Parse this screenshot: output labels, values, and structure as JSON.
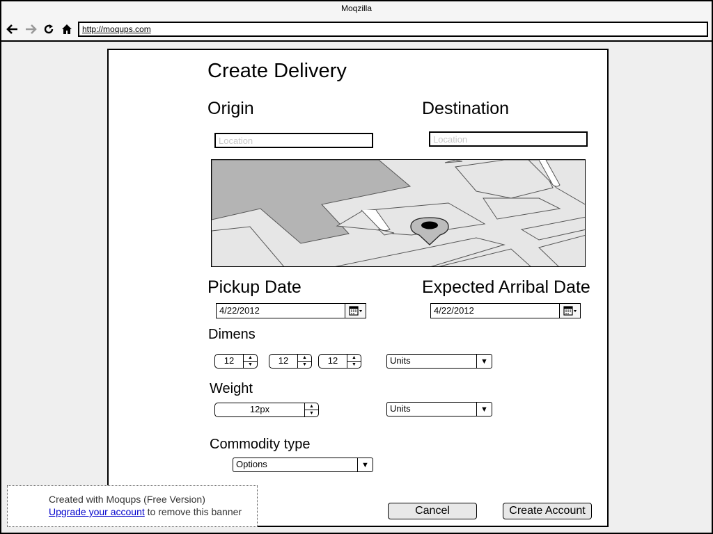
{
  "browser": {
    "title": "Moqzilla",
    "url": "http://moqups.com"
  },
  "form": {
    "title": "Create Delivery",
    "origin": {
      "label": "Origin",
      "placeholder": "Location"
    },
    "destination": {
      "label": "Destination",
      "placeholder": "Location"
    },
    "pickup_date": {
      "label": "Pickup Date",
      "value": "4/22/2012"
    },
    "expected_date": {
      "label": "Expected Arribal Date",
      "value": "4/22/2012"
    },
    "dimens": {
      "label": "Dimens",
      "values": [
        "12",
        "12",
        "12"
      ],
      "units": "Units"
    },
    "weight": {
      "label": "Weight",
      "value": "12px",
      "units": "Units"
    },
    "commodity": {
      "label": "Commodity type",
      "value": "Options"
    },
    "buttons": {
      "cancel": "Cancel",
      "create": "Create Account"
    }
  },
  "banner": {
    "line1": "Created with Moqups (Free Version)",
    "link": "Upgrade your account",
    "line2_suffix": " to remove this banner"
  },
  "icons": {
    "back": "arrow-left-icon",
    "forward": "arrow-right-icon",
    "reload": "reload-icon",
    "home": "home-icon",
    "calendar": "calendar-icon",
    "map_pin": "map-pin-icon"
  }
}
